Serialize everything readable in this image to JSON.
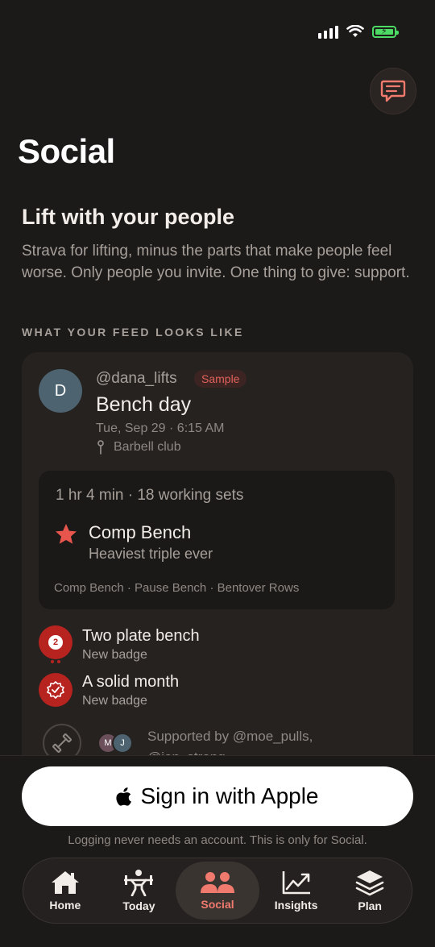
{
  "status_bar": {
    "icons": [
      "signal-icon",
      "wifi-icon",
      "battery-charging-icon"
    ]
  },
  "header": {
    "title": "Social",
    "chat_icon": "chat-bubble-icon"
  },
  "intro": {
    "headline": "Lift with your people",
    "description": "Strava for lifting, minus the parts that make people feel worse. Only people you invite. One thing to give: support."
  },
  "feed": {
    "section_label": "WHAT YOUR FEED LOOKS LIKE",
    "post": {
      "avatar_initial": "D",
      "handle": "@dana_lifts",
      "tag": "Sample",
      "title": "Bench day",
      "datetime": "Tue, Sep 29 · 6:15 AM",
      "location": "Barbell club",
      "workout": {
        "summary": "1 hr 4 min · 18 working sets",
        "pr_title": "Comp Bench",
        "pr_subtitle": "Heaviest triple ever",
        "exercises": "Comp Bench · Pause Bench · Bentover Rows"
      },
      "badges": [
        {
          "title": "Two plate bench",
          "subtitle": "New badge",
          "icon_text": "2"
        },
        {
          "title": "A solid month",
          "subtitle": "New badge"
        }
      ],
      "support": {
        "avatars": [
          "M",
          "J"
        ],
        "text": "Supported by @moe_pulls, @jon_strong"
      }
    }
  },
  "signin": {
    "button_label": "Sign in with Apple",
    "note": "Logging never needs an account. This is only for Social."
  },
  "tabs": [
    {
      "label": "Home",
      "icon": "home-icon"
    },
    {
      "label": "Today",
      "icon": "lifter-icon"
    },
    {
      "label": "Social",
      "icon": "people-icon",
      "active": true
    },
    {
      "label": "Insights",
      "icon": "chart-icon"
    },
    {
      "label": "Plan",
      "icon": "layers-icon"
    }
  ],
  "colors": {
    "accent": "#f07a6d",
    "badge": "#b7231f",
    "background": "#1c1a19"
  }
}
